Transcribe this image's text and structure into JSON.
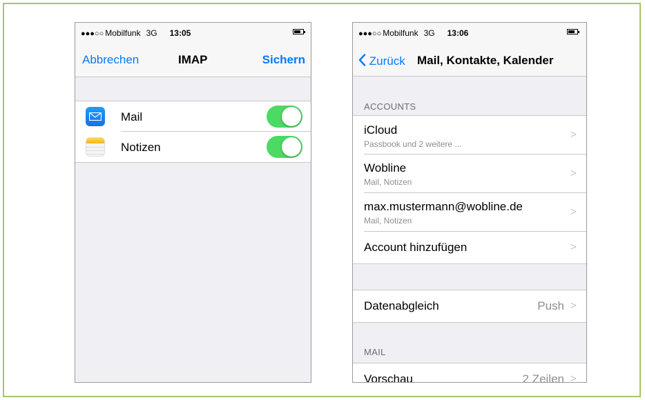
{
  "left_screen": {
    "status": {
      "signal": "●●●○○",
      "carrier": "Mobilfunk",
      "network": "3G",
      "time": "13:05"
    },
    "nav": {
      "cancel": "Abbrechen",
      "title": "IMAP",
      "save": "Sichern"
    },
    "rows": [
      {
        "label": "Mail",
        "icon": "mail-app-icon",
        "enabled": true
      },
      {
        "label": "Notizen",
        "icon": "notes-app-icon",
        "enabled": true
      }
    ]
  },
  "right_screen": {
    "status": {
      "signal": "●●●○○",
      "carrier": "Mobilfunk",
      "network": "3G",
      "time": "13:06"
    },
    "nav": {
      "back_label": "Zurück",
      "title": "Mail, Kontakte, Kalender"
    },
    "accounts_header": "ACCOUNTS",
    "accounts": [
      {
        "title": "iCloud",
        "subtitle": "Passbook und 2 weitere ..."
      },
      {
        "title": "Wobline",
        "subtitle": "Mail, Notizen"
      },
      {
        "title": "max.mustermann@wobline.de",
        "subtitle": "Mail, Notizen"
      },
      {
        "title": "Account hinzufügen",
        "subtitle": ""
      }
    ],
    "fetch": {
      "label": "Datenabgleich",
      "value": "Push"
    },
    "mail_header": "MAIL",
    "preview": {
      "label": "Vorschau",
      "value": "2 Zeilen"
    }
  },
  "colors": {
    "frame_border": "#a6c468",
    "ios_blue": "#007aff",
    "toggle_on": "#4cd964",
    "grouped_background": "#efeff4"
  }
}
